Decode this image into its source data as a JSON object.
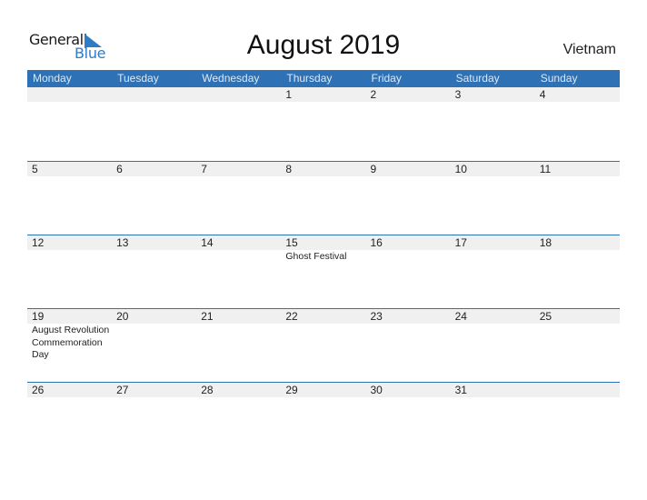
{
  "logo": {
    "general": "General",
    "blue": "Blue"
  },
  "title": "August 2019",
  "country": "Vietnam",
  "colors": {
    "header": "#2e72b5",
    "band": "#f0f0f0",
    "logo_blue": "#2e7bc6"
  },
  "days": [
    "Monday",
    "Tuesday",
    "Wednesday",
    "Thursday",
    "Friday",
    "Saturday",
    "Sunday"
  ],
  "weeks": [
    {
      "cells": [
        {
          "n": ""
        },
        {
          "n": ""
        },
        {
          "n": ""
        },
        {
          "n": "1"
        },
        {
          "n": "2"
        },
        {
          "n": "3"
        },
        {
          "n": "4"
        }
      ]
    },
    {
      "cells": [
        {
          "n": "5"
        },
        {
          "n": "6"
        },
        {
          "n": "7"
        },
        {
          "n": "8"
        },
        {
          "n": "9"
        },
        {
          "n": "10"
        },
        {
          "n": "11"
        }
      ]
    },
    {
      "cells": [
        {
          "n": "12"
        },
        {
          "n": "13"
        },
        {
          "n": "14"
        },
        {
          "n": "15",
          "event": "Ghost Festival"
        },
        {
          "n": "16"
        },
        {
          "n": "17"
        },
        {
          "n": "18"
        }
      ]
    },
    {
      "cells": [
        {
          "n": "19",
          "event": "August Revolution Commemoration Day"
        },
        {
          "n": "20"
        },
        {
          "n": "21"
        },
        {
          "n": "22"
        },
        {
          "n": "23"
        },
        {
          "n": "24"
        },
        {
          "n": "25"
        }
      ]
    },
    {
      "cells": [
        {
          "n": "26"
        },
        {
          "n": "27"
        },
        {
          "n": "28"
        },
        {
          "n": "29"
        },
        {
          "n": "30"
        },
        {
          "n": "31"
        },
        {
          "n": ""
        }
      ]
    }
  ]
}
